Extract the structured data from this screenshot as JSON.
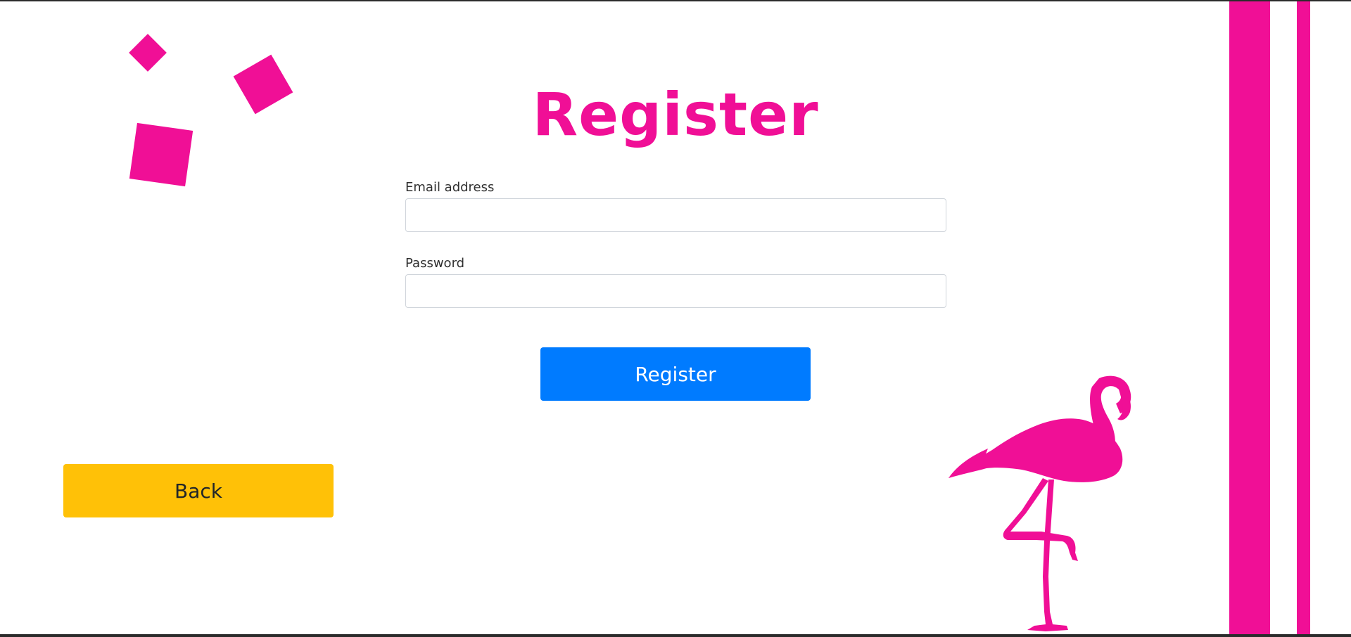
{
  "colors": {
    "accent": "#f00f96",
    "primary_button": "#007bff",
    "back_button": "#ffc107"
  },
  "page": {
    "title": "Register"
  },
  "form": {
    "email_label": "Email address",
    "email_value": "",
    "password_label": "Password",
    "password_value": ""
  },
  "buttons": {
    "register_label": "Register",
    "back_label": "Back"
  },
  "decorations": {
    "squares_icon": "square-icon",
    "stripes_icon": "stripe-icon",
    "flamingo_icon": "flamingo-icon"
  }
}
